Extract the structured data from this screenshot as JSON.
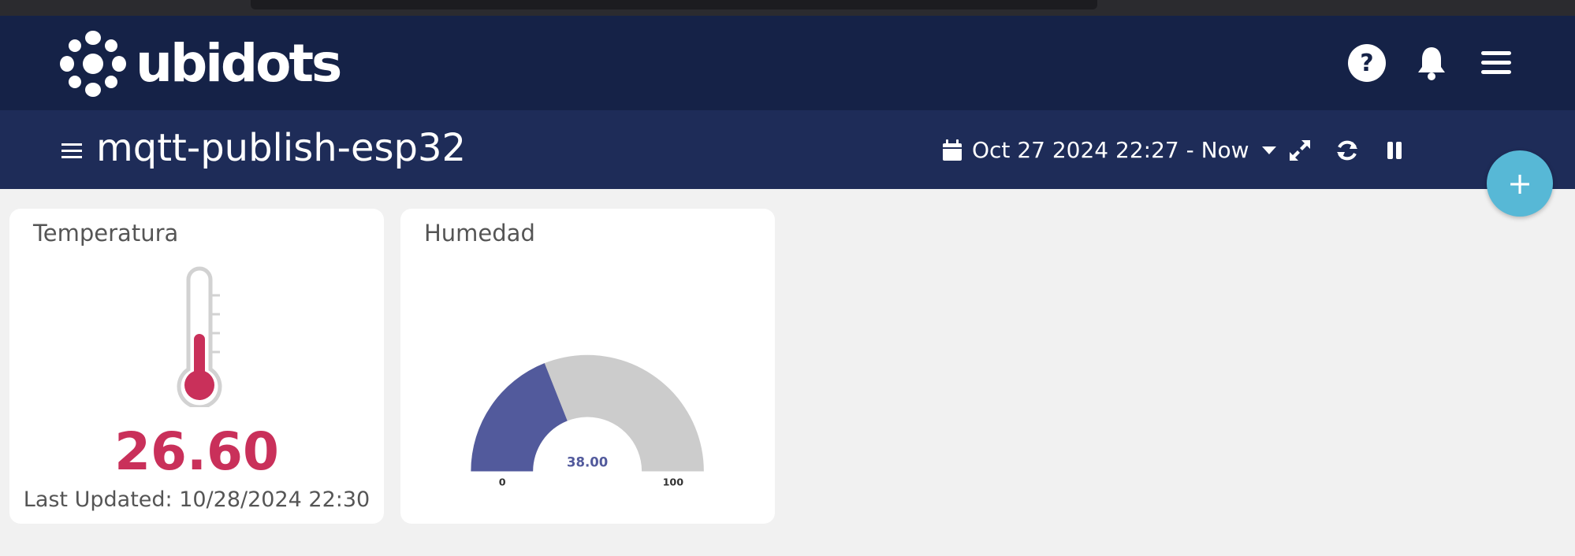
{
  "header": {
    "logo_text": "ubidots",
    "icons": [
      "help-icon",
      "bell-icon",
      "menu-icon"
    ]
  },
  "dashboard": {
    "title": "mqtt-publish-esp32",
    "date_range": "Oct 27 2024 22:27 - Now",
    "add_label": "+"
  },
  "widgets": {
    "temperature": {
      "title": "Temperatura",
      "value": "26.60",
      "last_updated": "Last Updated: 10/28/2024 22:30",
      "color": "#c9305a"
    },
    "humidity": {
      "title": "Humedad",
      "value": "38.00",
      "min_label": "0",
      "max_label": "100",
      "fraction": 0.38,
      "color": "#525a9c"
    }
  },
  "colors": {
    "topbar": "#152247",
    "subbar": "#1e2c58",
    "fab": "#57b8d6",
    "gauge_track": "#cccccc"
  }
}
